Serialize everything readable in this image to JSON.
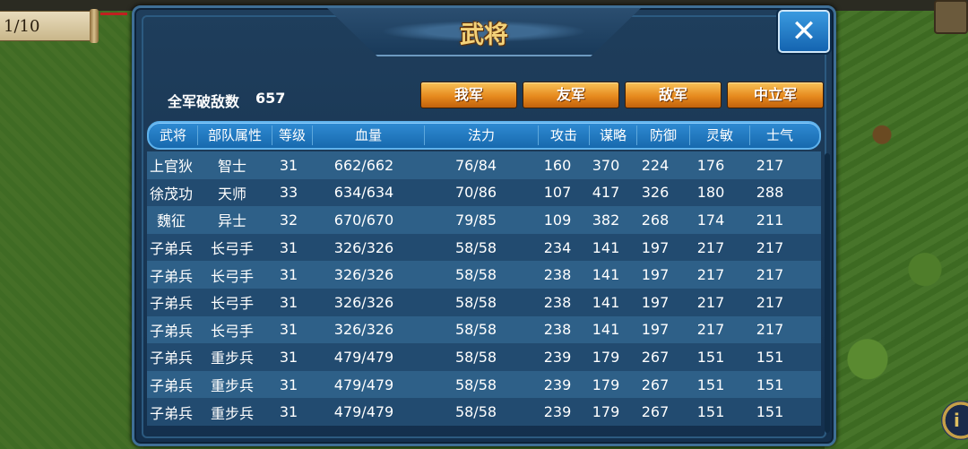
{
  "hud": {
    "turn_counter": "1/10"
  },
  "dialog": {
    "title": "武将",
    "close_label": "✕",
    "kill_label": "全军破敌数",
    "kill_count": "657",
    "tabs": [
      {
        "label": "我军"
      },
      {
        "label": "友军"
      },
      {
        "label": "敌军"
      },
      {
        "label": "中立军"
      }
    ],
    "columns": [
      "武将",
      "部队属性",
      "等级",
      "血量",
      "法力",
      "攻击",
      "谋略",
      "防御",
      "灵敏",
      "士气"
    ],
    "rows": [
      [
        "上官狄",
        "智士",
        "31",
        "662/662",
        "76/84",
        "160",
        "370",
        "224",
        "176",
        "217"
      ],
      [
        "徐茂功",
        "天师",
        "33",
        "634/634",
        "70/86",
        "107",
        "417",
        "326",
        "180",
        "288"
      ],
      [
        "魏征",
        "异士",
        "32",
        "670/670",
        "79/85",
        "109",
        "382",
        "268",
        "174",
        "211"
      ],
      [
        "子弟兵",
        "长弓手",
        "31",
        "326/326",
        "58/58",
        "234",
        "141",
        "197",
        "217",
        "217"
      ],
      [
        "子弟兵",
        "长弓手",
        "31",
        "326/326",
        "58/58",
        "238",
        "141",
        "197",
        "217",
        "217"
      ],
      [
        "子弟兵",
        "长弓手",
        "31",
        "326/326",
        "58/58",
        "238",
        "141",
        "197",
        "217",
        "217"
      ],
      [
        "子弟兵",
        "长弓手",
        "31",
        "326/326",
        "58/58",
        "238",
        "141",
        "197",
        "217",
        "217"
      ],
      [
        "子弟兵",
        "重步兵",
        "31",
        "479/479",
        "58/58",
        "239",
        "179",
        "267",
        "151",
        "151"
      ],
      [
        "子弟兵",
        "重步兵",
        "31",
        "479/479",
        "58/58",
        "239",
        "179",
        "267",
        "151",
        "151"
      ],
      [
        "子弟兵",
        "重步兵",
        "31",
        "479/479",
        "58/58",
        "239",
        "179",
        "267",
        "151",
        "151"
      ]
    ]
  }
}
